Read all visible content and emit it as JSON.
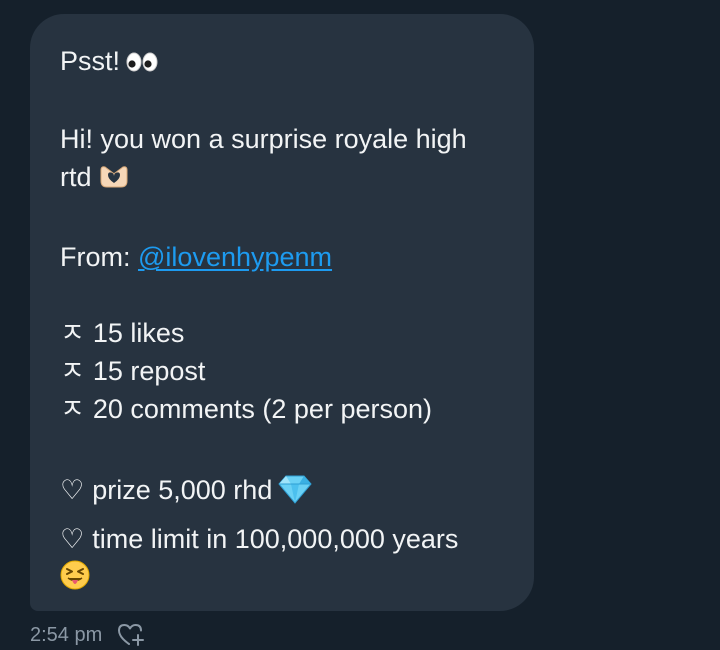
{
  "message": {
    "greeting": "Psst!",
    "greeting_emoji": "eyes-emoji",
    "body_line1": "Hi! you won a surprise royale high",
    "body_line2": "rtd",
    "body_line2_emoji": "heart-hands-emoji",
    "from_label": "From:",
    "from_mention": "@ilovenhypenm",
    "requirement_prefix": "ㅈ",
    "requirements": [
      "15 likes",
      "15 repost",
      "20 comments (2 per person)"
    ],
    "heart_prefix": "♡",
    "prize_text": "prize 5,000 rhd",
    "prize_emoji": "gem-emoji",
    "time_limit_text": "time limit in 100,000,000 years",
    "closing_emoji": "squinting-tongue-emoji"
  },
  "meta": {
    "timestamp": "2:54 pm",
    "react_icon": "heart-plus-icon"
  },
  "colors": {
    "background": "#15202b",
    "bubble": "#273340",
    "text": "#f2f4f5",
    "link": "#1d9bf0",
    "muted": "#8b98a5"
  }
}
